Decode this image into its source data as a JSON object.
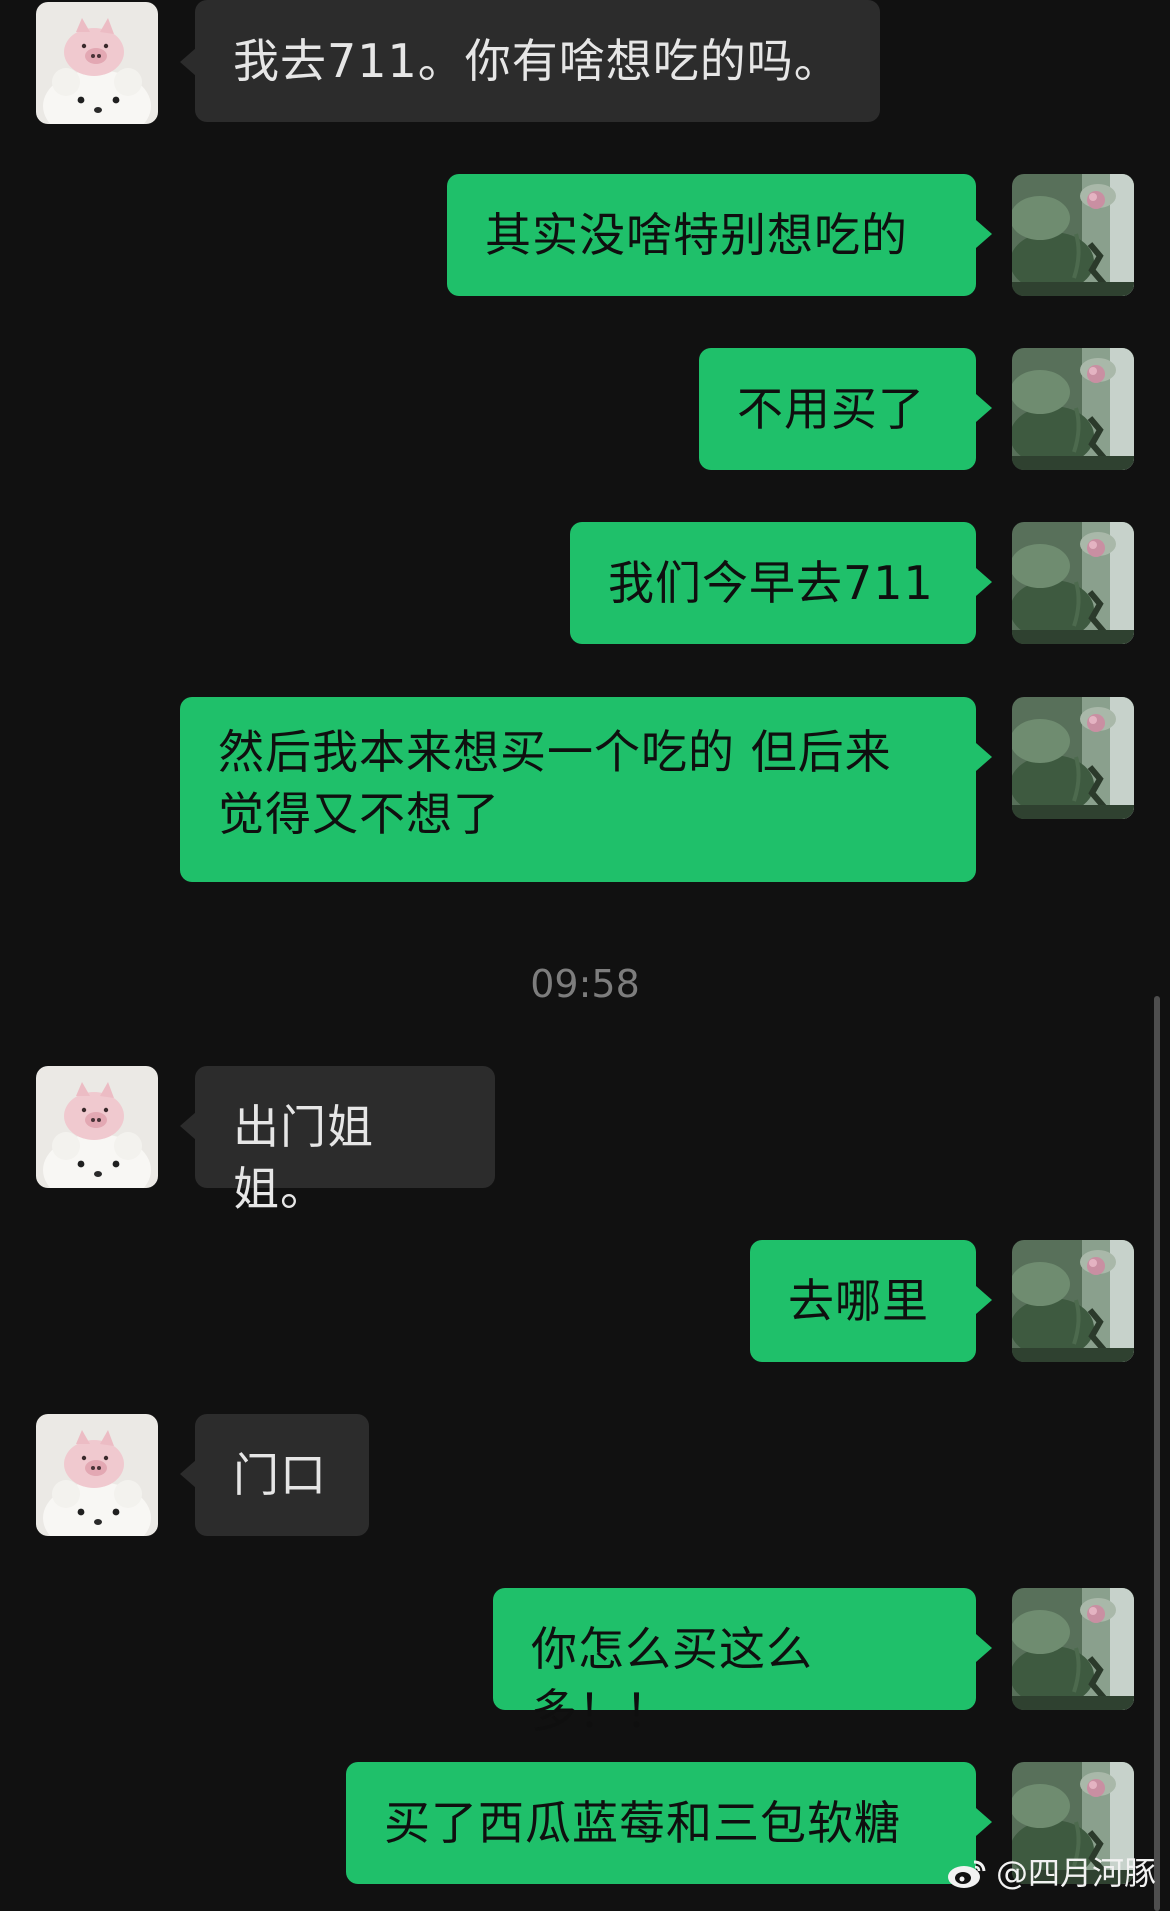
{
  "messages": [
    {
      "side": "in",
      "text": "我去711。你有啥想吃的吗。"
    },
    {
      "side": "out",
      "text": "其实没啥特别想吃的"
    },
    {
      "side": "out",
      "text": "不用买了"
    },
    {
      "side": "out",
      "text": "我们今早去711"
    },
    {
      "side": "out",
      "text": "然后我本来想买一个吃的 但后来觉得又不想了"
    },
    {
      "side": "time",
      "text": "09:58"
    },
    {
      "side": "in",
      "text": "出门姐姐。"
    },
    {
      "side": "out",
      "text": "去哪里"
    },
    {
      "side": "in",
      "text": "门口"
    },
    {
      "side": "out",
      "text": "你怎么买这么多！！"
    },
    {
      "side": "out",
      "text": "买了西瓜蓝莓和三包软糖"
    }
  ],
  "watermark": {
    "text": "@四月河豚",
    "icon": "weibo-icon"
  },
  "colors": {
    "background": "#111111",
    "incoming_bubble": "#2c2c2c",
    "outgoing_bubble": "#1fc06a",
    "timestamp": "#7d7d7d"
  },
  "avatars": {
    "contact": "pig-bear-plush-avatar",
    "self": "lotus-leaf-photo-avatar"
  }
}
